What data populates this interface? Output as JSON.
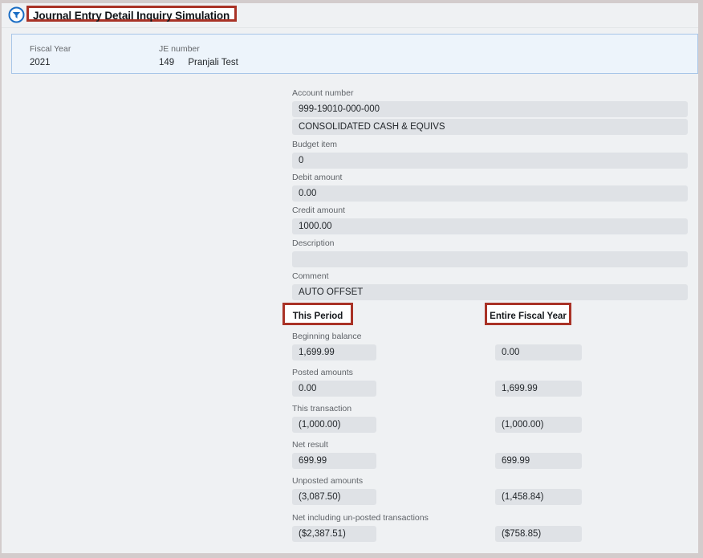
{
  "header": {
    "title": "Journal Entry Detail Inquiry Simulation",
    "collapse_icon": "filter-circle-icon",
    "accent_color": "#a93226",
    "title_box_background": "#ffffff"
  },
  "info_banner": {
    "background": "#edf4fb",
    "border_color": "#a8c6e8",
    "fields": [
      {
        "label": "Fiscal Year",
        "value": "2021",
        "secondary": ""
      },
      {
        "label": "JE number",
        "value": "149",
        "secondary": "Pranjali Test"
      }
    ]
  },
  "form": {
    "field_background": "#dfe2e6",
    "page_background": "#eff1f3",
    "single_fields": [
      {
        "label": "Account number",
        "value": "999-19010-000-000"
      },
      {
        "label": "",
        "value": "CONSOLIDATED CASH & EQUIVS"
      },
      {
        "label": "Budget item",
        "value": "0"
      },
      {
        "label": "Debit amount",
        "value": "0.00"
      },
      {
        "label": "Credit amount",
        "value": "1000.00"
      },
      {
        "label": "Description",
        "value": ""
      },
      {
        "label": "Comment",
        "value": "AUTO OFFSET"
      }
    ],
    "column_headings": {
      "this_period": "This Period",
      "entire_fiscal_year": "Entire Fiscal Year"
    },
    "comparison_rows": [
      {
        "label": "Beginning balance",
        "this_period": "1,699.99",
        "entire_fiscal_year": "0.00"
      },
      {
        "label": "Posted amounts",
        "this_period": "0.00",
        "entire_fiscal_year": "1,699.99"
      },
      {
        "label": "This transaction",
        "this_period": "(1,000.00)",
        "entire_fiscal_year": "(1,000.00)"
      },
      {
        "label": "Net result",
        "this_period": "699.99",
        "entire_fiscal_year": "699.99"
      },
      {
        "label": "Unposted amounts",
        "this_period": "(3,087.50)",
        "entire_fiscal_year": "(1,458.84)"
      },
      {
        "label": "Net including un-posted transactions",
        "this_period": "($2,387.51)",
        "entire_fiscal_year": "($758.85)"
      }
    ]
  }
}
